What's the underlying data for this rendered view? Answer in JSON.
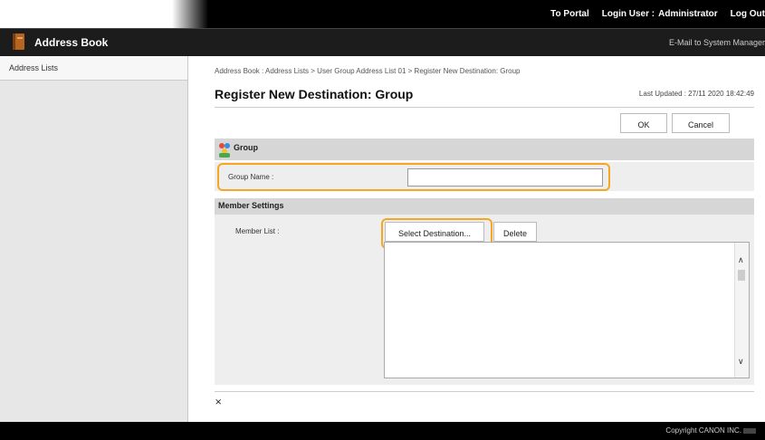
{
  "topnav": {
    "portal": "To Portal",
    "login_label": "Login User :",
    "user": "Administrator",
    "logout": "Log Out"
  },
  "app": {
    "title": "Address Book",
    "mail": "E-Mail to System Manager"
  },
  "sidebar": {
    "items": [
      {
        "label": "Address Lists"
      }
    ]
  },
  "breadcrumb": "Address Book : Address Lists > User Group Address List 01 > Register New Destination: Group",
  "page": {
    "title": "Register New Destination: Group",
    "updated": "Last Updated : 27/11 2020 18:42:49"
  },
  "buttons": {
    "ok": "OK",
    "cancel": "Cancel",
    "select_destination": "Select Destination...",
    "delete": "Delete"
  },
  "group": {
    "title": "Group",
    "name_label": "Group Name :",
    "name_value": ""
  },
  "member": {
    "title": "Member Settings",
    "list_label": "Member List :"
  },
  "icons": {
    "top": "⨯",
    "up": "∧",
    "down": "∨"
  },
  "footer": {
    "copyright": "Copyright CANON INC."
  },
  "colors": {
    "highlight": "#f5a623",
    "header_bg": "#000000",
    "section_bg": "#d6d6d6"
  }
}
